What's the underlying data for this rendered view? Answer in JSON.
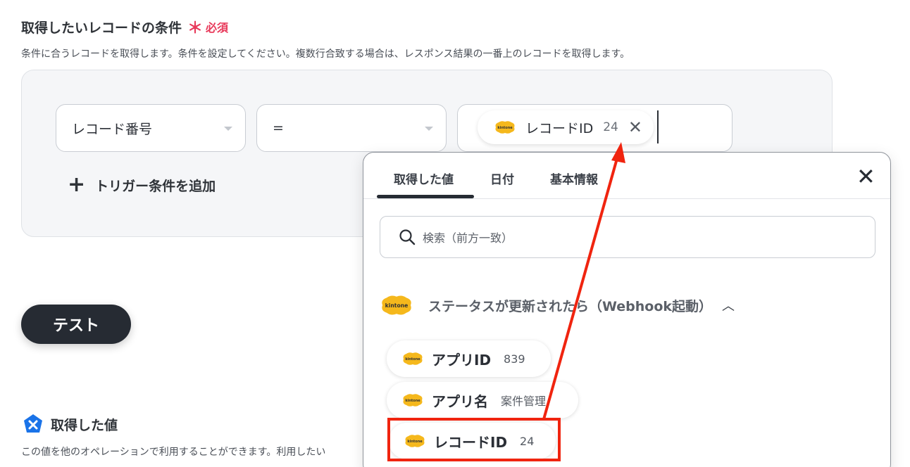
{
  "section": {
    "title": "取得したいレコードの条件",
    "required_mark": "＊",
    "required_text": "必須",
    "description": "条件に合うレコードを取得します。条件を設定してください。複数行合致する場合は、レスポンス結果の一番上のレコードを取得します。"
  },
  "condition": {
    "field_select": "レコード番号",
    "operator_select": "=",
    "value_chip": {
      "label": "レコードID",
      "value": "24"
    }
  },
  "add_trigger_label": "トリガー条件を追加",
  "test_button_label": "テスト",
  "acquired": {
    "title": "取得した値",
    "description": "この値を他のオペレーションで利用することができます。利用したい"
  },
  "popup": {
    "tabs": [
      "取得した値",
      "日付",
      "基本情報"
    ],
    "active_tab": 0,
    "search_placeholder": "検索（前方一致）",
    "group_name": "ステータスが更新されたら（Webhook起動）",
    "items": [
      {
        "label": "アプリID",
        "value": "839"
      },
      {
        "label": "アプリ名",
        "value": "案件管理"
      },
      {
        "label": "レコードID",
        "value": "24"
      }
    ]
  },
  "colors": {
    "accent_red": "#f0240f",
    "required_pink": "#e8395a",
    "kintone_yellow": "#f5b81c",
    "dark_button": "#262b33"
  }
}
